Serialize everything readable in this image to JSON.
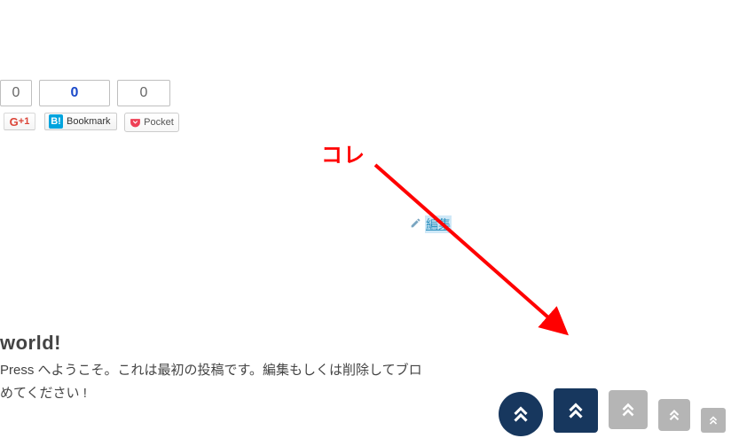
{
  "share": {
    "counts": {
      "gplus": "0",
      "hatena": "0",
      "pocket": "0"
    },
    "gplus_label": "+1",
    "hatena_label": "Bookmark",
    "hatena_icon": "B!",
    "pocket_label": "Pocket"
  },
  "edit": {
    "label": "編集"
  },
  "post": {
    "title": " world!",
    "line1": "Press へようこそ。これは最初の投稿です。編集もしくは削除してブロ",
    "line2": "めてください !"
  },
  "annotation": {
    "text": "コレ"
  },
  "colors": {
    "accent": "#17375e",
    "grayBtn": "#b5b5b5",
    "arrow": "#ff0000",
    "link": "#2a8fbd"
  }
}
